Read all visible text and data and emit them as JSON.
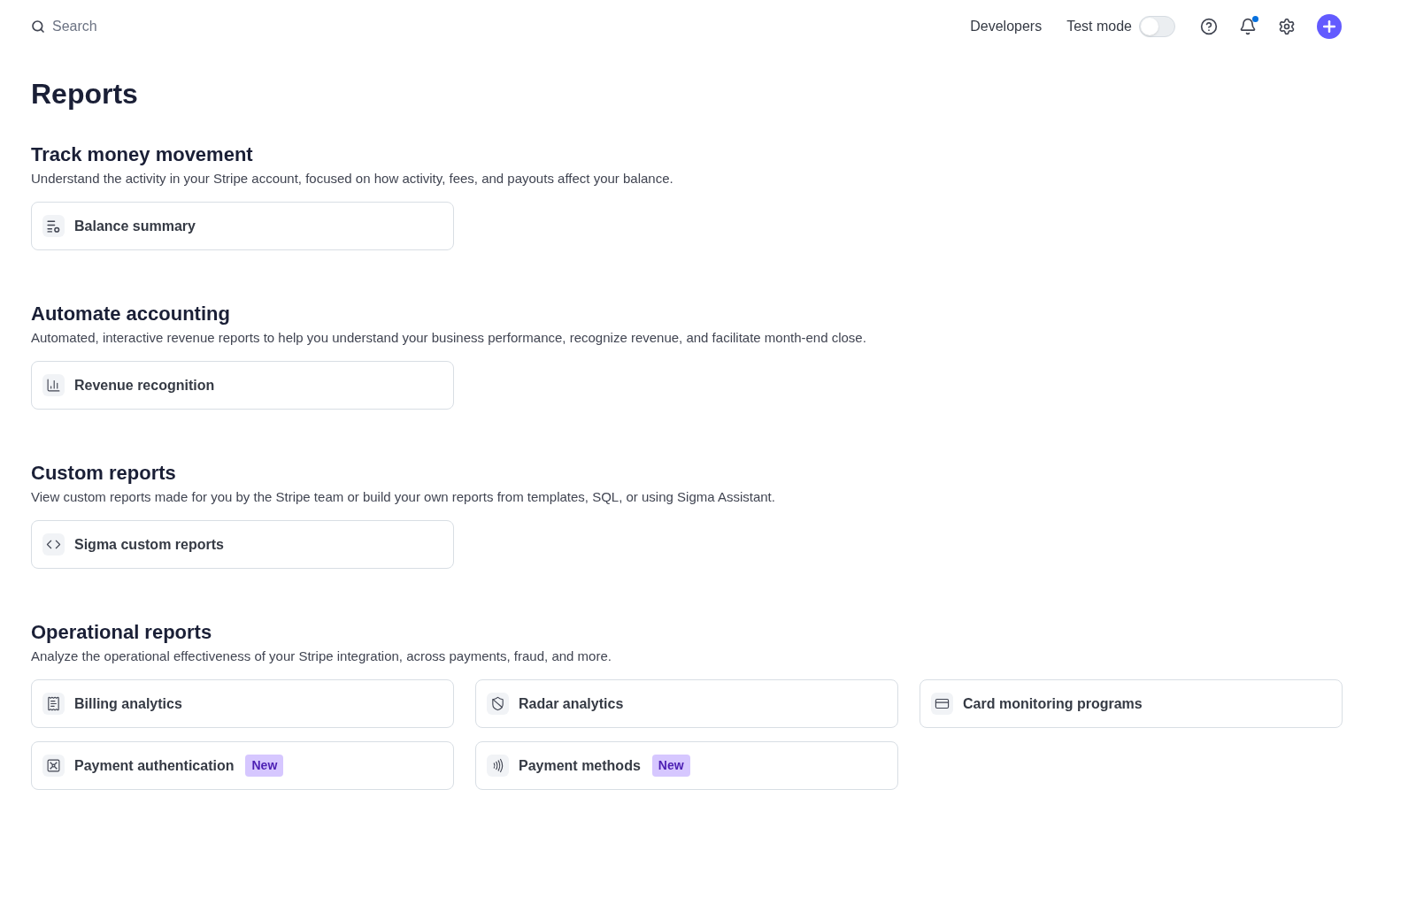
{
  "top_bar": {
    "search": {
      "placeholder": "Search"
    },
    "developers_link": "Developers",
    "test_mode": {
      "label": "Test mode",
      "on": false
    }
  },
  "page_title": "Reports",
  "sections": [
    {
      "title": "Track money movement",
      "description": "Understand the activity in your Stripe account, focused on how activity, fees, and payouts affect your balance.",
      "cards": [
        {
          "label": "Balance summary"
        }
      ]
    },
    {
      "title": "Automate accounting",
      "description": "Automated, interactive revenue reports to help you understand your business performance, recognize revenue, and facilitate month-end close.",
      "cards": [
        {
          "label": "Revenue recognition"
        }
      ]
    },
    {
      "title": "Custom reports",
      "description": "View custom reports made for you by the Stripe team or build your own reports from templates, SQL, or using Sigma Assistant.",
      "cards": [
        {
          "label": "Sigma custom reports"
        }
      ]
    },
    {
      "title": "Operational reports",
      "description": "Analyze the operational effectiveness of your Stripe integration, across payments, fraud, and more.",
      "cards": [
        {
          "label": "Billing analytics"
        },
        {
          "label": "Radar analytics"
        },
        {
          "label": "Card monitoring programs"
        },
        {
          "label": "Payment authentication",
          "badge": "New"
        },
        {
          "label": "Payment methods",
          "badge": "New"
        }
      ]
    }
  ]
}
